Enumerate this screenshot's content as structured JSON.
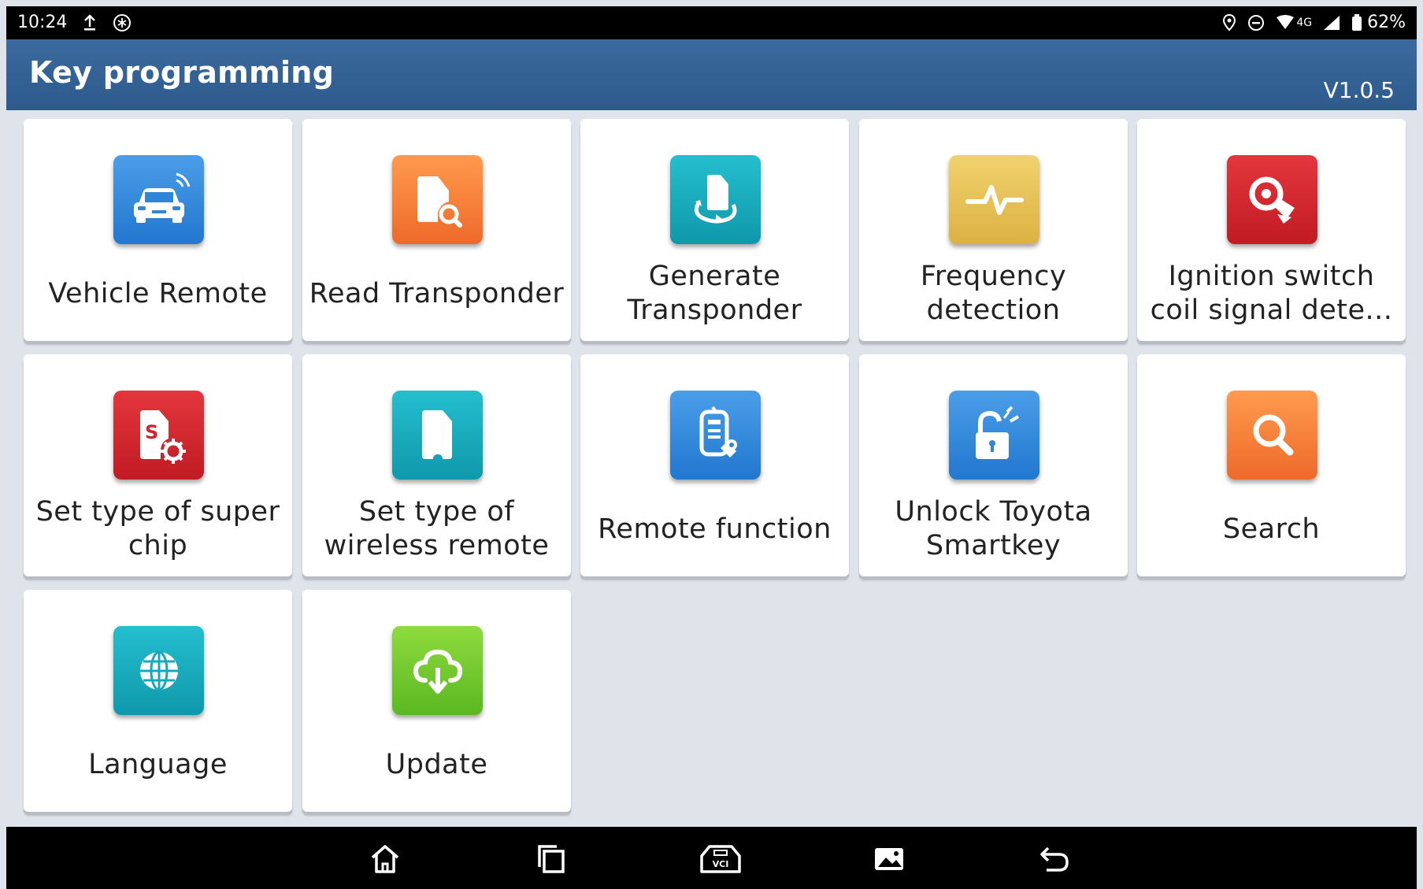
{
  "status": {
    "time": "10:24",
    "battery": "62%",
    "network": "4G"
  },
  "header": {
    "title": "Key programming",
    "version": "V1.0.5"
  },
  "tiles": [
    {
      "label": "Vehicle Remote",
      "icon": "car-remote-icon",
      "color": "#2f86d8"
    },
    {
      "label": "Read Transponder",
      "icon": "transponder-search-icon",
      "color": "#f47a34"
    },
    {
      "label": "Generate Transponder",
      "icon": "transponder-generate-icon",
      "color": "#16a9bb"
    },
    {
      "label": "Frequency detection",
      "icon": "pulse-icon",
      "color": "#e5bf55"
    },
    {
      "label": "Ignition switch coil signal dete...",
      "icon": "ignition-coil-icon",
      "color": "#d1252d"
    },
    {
      "label": "Set type of super chip",
      "icon": "super-chip-icon",
      "color": "#d1252d"
    },
    {
      "label": "Set type of wireless remote",
      "icon": "wireless-remote-icon",
      "color": "#16a9bb"
    },
    {
      "label": "Remote function",
      "icon": "remote-function-icon",
      "color": "#2f86d8"
    },
    {
      "label": "Unlock Toyota Smartkey",
      "icon": "unlock-icon",
      "color": "#2f86d8"
    },
    {
      "label": "Search",
      "icon": "search-icon",
      "color": "#f47a34"
    },
    {
      "label": "Language",
      "icon": "globe-icon",
      "color": "#16a9bb"
    },
    {
      "label": "Update",
      "icon": "cloud-download-icon",
      "color": "#6cc42c"
    }
  ],
  "navbar": {
    "buttons": [
      "home-icon",
      "recent-apps-icon",
      "vci-icon",
      "gallery-icon",
      "back-icon"
    ]
  }
}
